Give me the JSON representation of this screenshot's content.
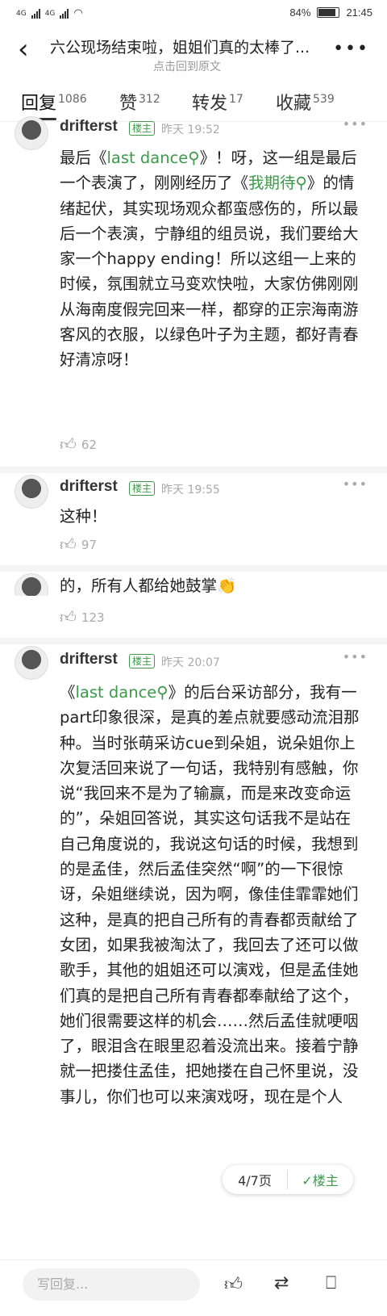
{
  "status": {
    "signal1": "4G",
    "signal2": "4G",
    "battery": "84%",
    "time": "21:45"
  },
  "header": {
    "title": "六公现场结束啦，姐姐们真的太棒了...",
    "subtitle": "点击回到原文"
  },
  "tabs": [
    {
      "label": "回复",
      "count": "1086"
    },
    {
      "label": "赞",
      "count": "312"
    },
    {
      "label": "转发",
      "count": "17"
    },
    {
      "label": "收藏",
      "count": "539"
    }
  ],
  "comments": [
    {
      "user": "drifterst",
      "badge": "楼主",
      "time": "昨天 19:52",
      "parts": [
        "最后《",
        "last dance",
        "》！呀，这一组是最后一个表演了，刚刚经历了《",
        "我期待",
        "》的情绪起伏，其实现场观众都蛮感伤的，所以最后一个表演，宁静组的组员说，我们要给大家一个happy ending！所以这组一上来的时候，氛围就立马变欢快啦，大家仿佛刚刚从海南度假完回来一样，都穿的正宗海南游客风的衣服，以绿色叶子为主题，都好青春好清凉呀！"
      ],
      "likes": "62"
    },
    {
      "user": "drifterst",
      "badge": "楼主",
      "time": "昨天 19:55",
      "text": "这种！",
      "likes": "97"
    },
    {
      "partial": "的，所有人都给她鼓掌",
      "emoji": "👏",
      "likes": "123"
    },
    {
      "user": "drifterst",
      "badge": "楼主",
      "time": "昨天 20:07",
      "parts": [
        "《",
        "last dance",
        "》的后台采访部分，我有一part印象很深，是真的差点就要感动流泪那种。当时张萌采访cue到朵姐，说朵姐你上次复活回来说了一句话，我特别有感触，你说“我回来不是为了输赢，而是来改变命运的”，朵姐回答说，其实这句话我不是站在自己角度说的，我说这句话的时候，我想到的是孟佳，然后孟佳突然“啊”的一下很惊讶，朵姐继续说，因为啊，像佳佳霏霏她们这种，是真的把自己所有的青春都贡献给了女团，如果我被淘汰了，我回去了还可以做歌手，其他的姐姐还可以演戏，但是孟佳她们真的是把自己所有青春都奉献给了这个，她们很需要这样的机会……然后孟佳就哽咽了，眼泪含在眼里忍着没流出来。接着宁静就一把搂住孟佳，把她搂在自己怀里说，没事儿，你们也可以来演戏呀，现在是个人"
      ]
    }
  ],
  "pager": {
    "page": "4/7页",
    "op": "楼主"
  },
  "bottom": {
    "reply_placeholder": "写回复..."
  }
}
